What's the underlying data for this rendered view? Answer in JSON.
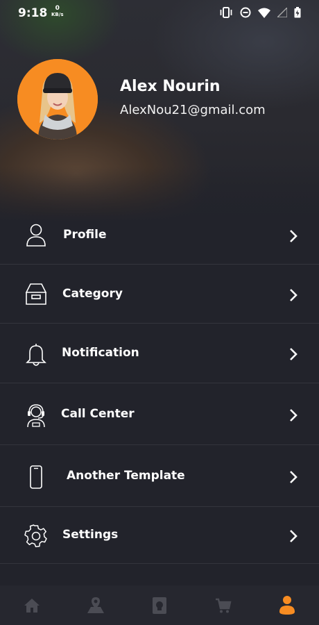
{
  "status_bar": {
    "time": "9:18",
    "speed_value": "0",
    "speed_unit": "KB/s",
    "icons": [
      "vibrate-icon",
      "do-not-disturb-icon",
      "wifi-icon",
      "signal-icon",
      "battery-charging-icon"
    ]
  },
  "profile": {
    "name": "Alex Nourin",
    "email": "AlexNou21@gmail.com",
    "avatar_bg": "#f78c22"
  },
  "menu": [
    {
      "label": "Profile",
      "icon": "user-icon"
    },
    {
      "label": "Category",
      "icon": "category-box-icon"
    },
    {
      "label": "Notification",
      "icon": "bell-icon"
    },
    {
      "label": "Call Center",
      "icon": "headset-agent-icon"
    },
    {
      "label": "Another Template",
      "icon": "smartphone-icon"
    },
    {
      "label": "Settings",
      "icon": "gear-icon"
    }
  ],
  "bottom_nav": {
    "items": [
      "home-icon",
      "map-pin-icon",
      "recipe-book-icon",
      "cart-icon",
      "person-icon"
    ],
    "active": "person-icon",
    "active_color": "#f78c22",
    "inactive_color": "#4b4c54"
  },
  "colors": {
    "background": "#22232b",
    "divider": "#34353d",
    "accent": "#f78c22"
  }
}
